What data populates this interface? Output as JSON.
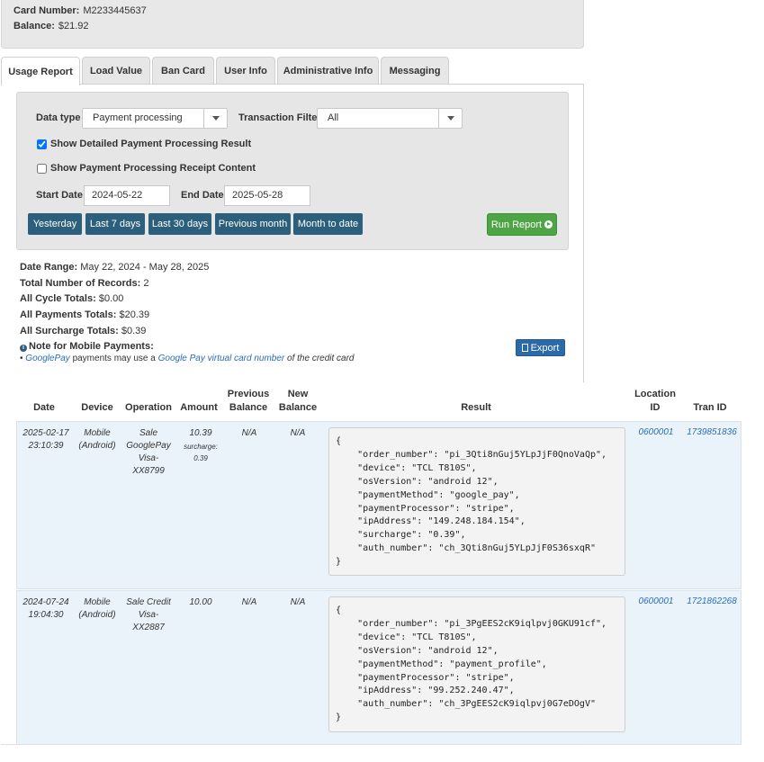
{
  "card": {
    "number_label": "Card Number:",
    "number_value": "M2233445637",
    "balance_label": "Balance:",
    "balance_value": "$21.92"
  },
  "tabs": [
    {
      "label": "Usage Report"
    },
    {
      "label": "Load Value"
    },
    {
      "label": "Ban Card"
    },
    {
      "label": "User Info"
    },
    {
      "label": "Administrative Info"
    },
    {
      "label": "Messaging"
    }
  ],
  "filters": {
    "data_type_label": "Data type",
    "data_type_value": "Payment processing",
    "transaction_filter_label": "Transaction Filter",
    "transaction_filter_value": "All",
    "show_detailed_label": "Show Detailed Payment Processing Result",
    "show_detailed_checked": true,
    "show_receipt_label": "Show Payment Processing Receipt Content",
    "show_receipt_checked": false,
    "start_date_label": "Start Date",
    "start_date_value": "2024-05-22",
    "end_date_label": "End Date",
    "end_date_value": "2025-05-28",
    "quick": [
      "Yesterday",
      "Last 7 days",
      "Last 30 days",
      "Previous month",
      "Month to date"
    ],
    "run_label": "Run Report"
  },
  "summary": {
    "date_range_label": "Date Range:",
    "date_range_value": "May 22, 2024 - May 28, 2025",
    "records_label": "Total Number of Records:",
    "records_value": "2",
    "cycle_label": "All Cycle Totals:",
    "cycle_value": "$0.00",
    "payments_label": "All Payments Totals:",
    "payments_value": "$20.39",
    "surcharge_label": "All Surcharge Totals:",
    "surcharge_value": "$0.39",
    "note_title": "Note for Mobile Payments:",
    "note_bullet": "•",
    "note_link1": "GooglePay",
    "note_text1": "payments may use a",
    "note_link2": "Google Pay virtual card number",
    "note_text2": "of the credit card",
    "export_label": "Export"
  },
  "table": {
    "headers": {
      "date": "Date",
      "device": "Device",
      "operation": "Operation",
      "amount": "Amount",
      "prev_balance_1": "Previous",
      "prev_balance_2": "Balance",
      "new_balance_1": "New",
      "new_balance_2": "Balance",
      "result": "Result",
      "location_1": "Location",
      "location_2": "ID",
      "tran_id": "Tran ID"
    },
    "rows": [
      {
        "date1": "2025-02-17",
        "date2": "23:10:39",
        "device1": "Mobile",
        "device2": "(Android)",
        "op1": "Sale",
        "op2": "GooglePay",
        "op3": "Visa-",
        "op4": "XX8799",
        "amount": "10.39",
        "surcharge_label": "surcharge:",
        "surcharge_value": "0.39",
        "prev": "N/A",
        "new": "N/A",
        "result": "{\n    \"order_number\": \"pi_3Qti8nGuj5YLpJjF0QnoVaQp\",\n    \"device\": \"TCL T810S\",\n    \"osVersion\": \"android 12\",\n    \"paymentMethod\": \"google_pay\",\n    \"paymentProcessor\": \"stripe\",\n    \"ipAddress\": \"149.248.184.154\",\n    \"surcharge\": \"0.39\",\n    \"auth_number\": \"ch_3Qti8nGuj5YLpJjF0S36sxqR\"\n}",
        "location": "0600001",
        "tran": "1739851836"
      },
      {
        "date1": "2024-07-24",
        "date2": "19:04:30",
        "device1": "Mobile",
        "device2": "(Android)",
        "op1": "Sale Credit",
        "op2": "Visa-",
        "op3": "XX2887",
        "op4": "",
        "amount": "10.00",
        "surcharge_label": "",
        "surcharge_value": "",
        "prev": "N/A",
        "new": "N/A",
        "result": "{\n    \"order_number\": \"pi_3PgEES2cK9iqlpvj0GKU91cf\",\n    \"device\": \"TCL T810S\",\n    \"osVersion\": \"android 12\",\n    \"paymentMethod\": \"payment_profile\",\n    \"paymentProcessor\": \"stripe\",\n    \"ipAddress\": \"99.252.240.47\",\n    \"auth_number\": \"ch_3PgEES2cK9iqlpvj0G7eDOgV\"\n}",
        "location": "0600001",
        "tran": "1721862268"
      }
    ]
  },
  "colors": {
    "primary_button": "#2b5f7c",
    "run_button": "#4ea545",
    "export_button": "#2b6aa8",
    "link": "#2a6db5",
    "row_bg": "#eaf3fa"
  },
  "icons": [
    "checkbox-icon",
    "caret-down-icon",
    "circle-arrow-right-icon",
    "info-icon",
    "file-export-icon"
  ]
}
